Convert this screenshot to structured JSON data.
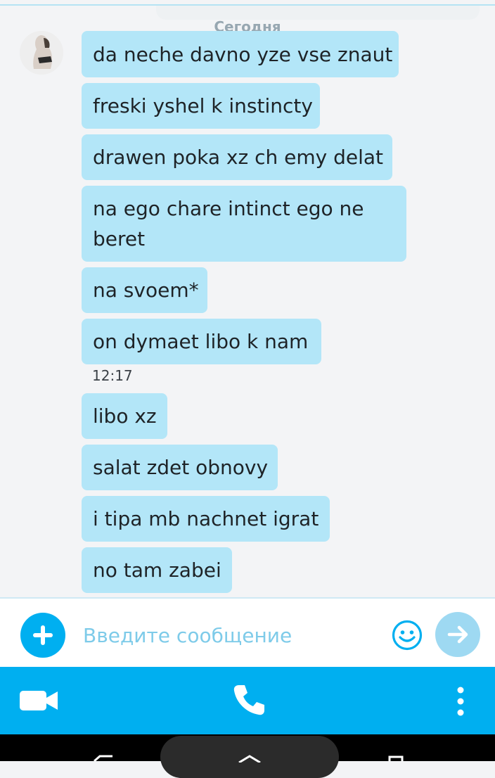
{
  "conversation": {
    "date_separator": "Сегодня",
    "messages": [
      {
        "text": "da neche davno yze vse znaut"
      },
      {
        "text": "freski yshel k instincty"
      },
      {
        "text": "drawen poka xz ch emy delat"
      },
      {
        "text": "na ego chare intinct ego ne\nberet"
      },
      {
        "text": "na svoem*"
      },
      {
        "text": "on dymaet libo k nam"
      },
      {
        "text": "libo xz"
      },
      {
        "text": "salat zdet obnovy"
      },
      {
        "text": "i tipa mb nachnet igrat"
      },
      {
        "text": "no tam zabei"
      }
    ],
    "timestamp": "12:17"
  },
  "composer": {
    "placeholder": "Введите сообщение",
    "value": ""
  },
  "action_bar": {
    "icons": [
      "video-camera-icon",
      "phone-icon",
      "more-vertical-icon"
    ]
  },
  "colors": {
    "accent": "#00aff0",
    "bubble": "#b3e6f8",
    "send_disabled": "#9ed9f2",
    "placeholder": "#7ecbe9"
  }
}
